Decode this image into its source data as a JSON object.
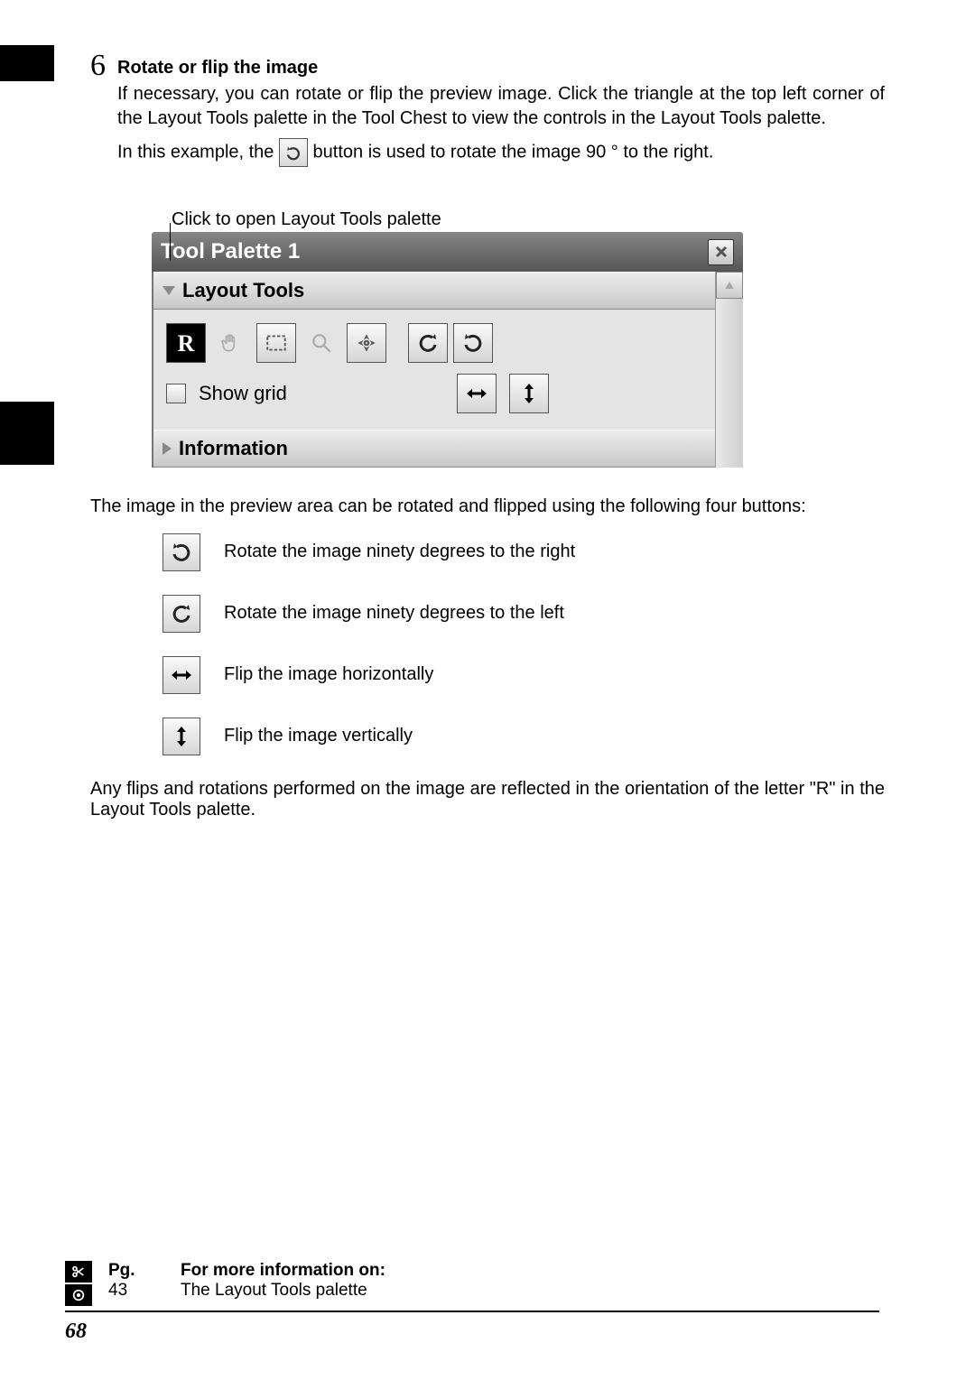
{
  "step": {
    "number": "6",
    "title": "Rotate or flip the image",
    "para1": "If necessary, you can rotate or flip the preview image.  Click the triangle at the top left corner of the Layout Tools palette in the Tool Chest to view the controls in the Layout Tools palette.",
    "example_before": "In this example, the ",
    "example_after": " button is used to rotate the image 90 ° to the right."
  },
  "palette_annotation": "Click to open Layout Tools palette",
  "palette": {
    "title": "Tool Palette 1",
    "section_layout": "Layout Tools",
    "show_grid_label": "Show grid",
    "section_information": "Information",
    "tools": {
      "r_indicator": "R"
    }
  },
  "after_palette_intro": "The image in the preview area can be rotated and flipped using the following four buttons:",
  "buttons_list": [
    {
      "name": "rotate-right",
      "label": "Rotate the image ninety degrees to the right"
    },
    {
      "name": "rotate-left",
      "label": "Rotate the image ninety degrees to the left"
    },
    {
      "name": "flip-horizontal",
      "label": "Flip the image horizontally"
    },
    {
      "name": "flip-vertical",
      "label": "Flip the image vertically"
    }
  ],
  "final_para": "Any flips and rotations performed on the image are reflected in the orientation of the letter \"R\" in the Layout Tools palette.",
  "refs": {
    "hdr_pg": "Pg.",
    "hdr_text": "For more information on:",
    "row1_pg": "43",
    "row1_text": "The Layout Tools palette"
  },
  "page_number": "68"
}
